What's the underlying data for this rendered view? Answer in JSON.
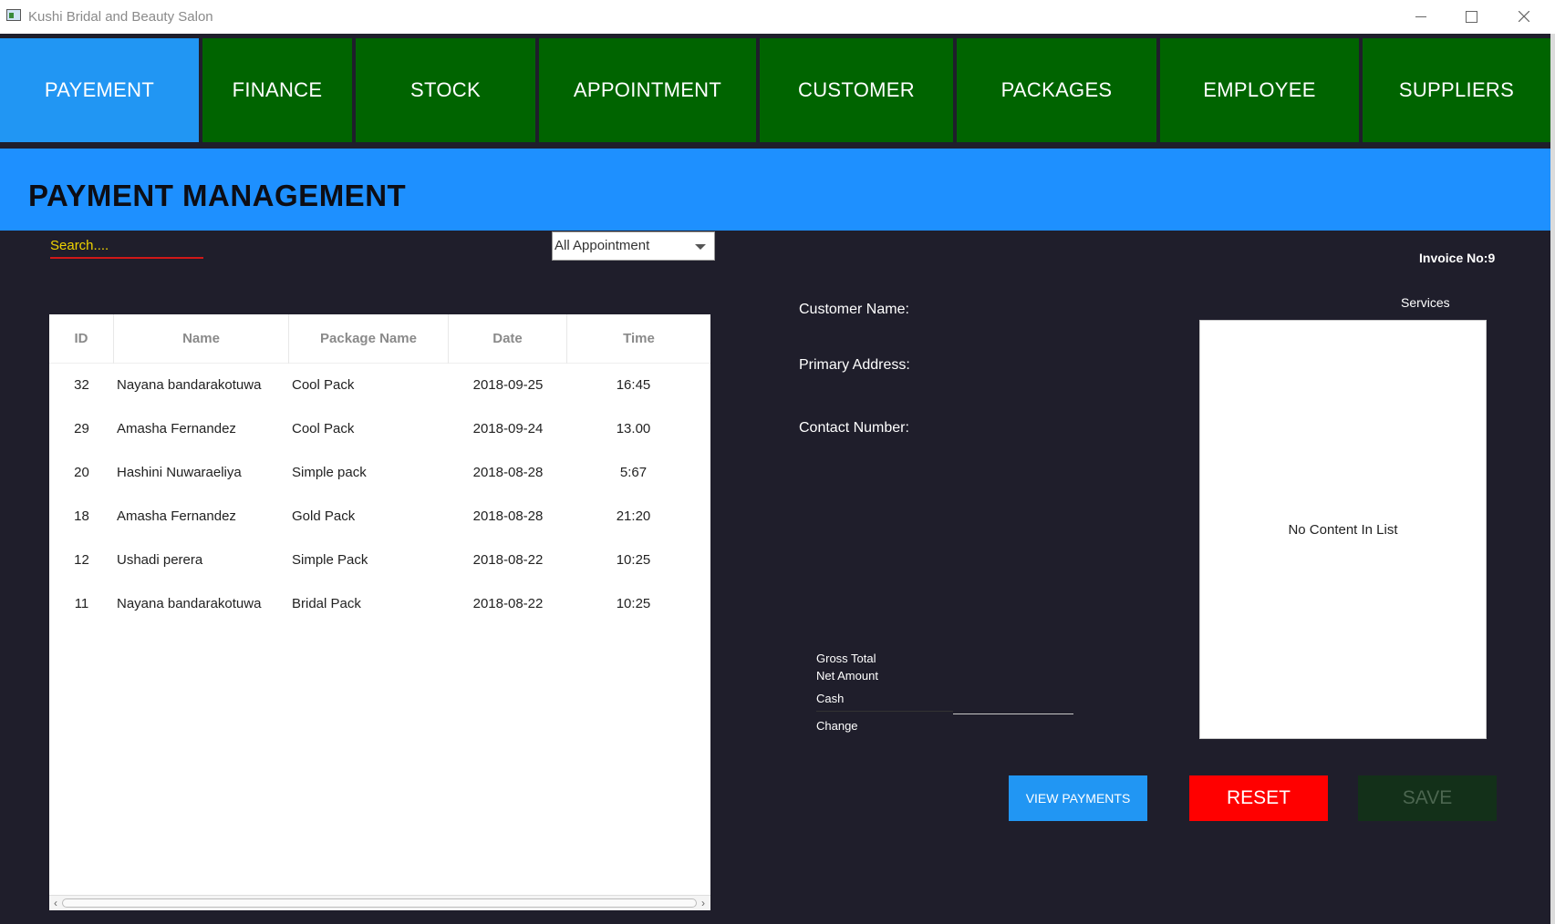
{
  "window": {
    "title": "Kushi Bridal and Beauty Salon",
    "minimize": "minimize-icon",
    "maximize": "maximize-icon",
    "close": "close-icon"
  },
  "nav": {
    "tabs": [
      {
        "label": "PAYEMENT",
        "active": true
      },
      {
        "label": "FINANCE"
      },
      {
        "label": "STOCK"
      },
      {
        "label": "APPOINTMENT"
      },
      {
        "label": "CUSTOMER"
      },
      {
        "label": "PACKAGES"
      },
      {
        "label": "EMPLOYEE"
      },
      {
        "label": "SUPPLIERS"
      }
    ]
  },
  "header": {
    "title": "PAYMENT MANAGEMENT"
  },
  "search": {
    "placeholder": "Search...."
  },
  "filter": {
    "selected": "All Appointment"
  },
  "table": {
    "columns": [
      "ID",
      "Name",
      "Package Name",
      "Date",
      "Time"
    ],
    "rows": [
      [
        "32",
        "Nayana bandarakotuwa",
        "Cool Pack",
        "2018-09-25",
        "16:45"
      ],
      [
        "29",
        "Amasha Fernandez",
        "Cool Pack",
        "2018-09-24",
        "13.00"
      ],
      [
        "20",
        "Hashini Nuwaraeliya",
        "Simple pack",
        "2018-08-28",
        "5:67"
      ],
      [
        "18",
        "Amasha Fernandez",
        "Gold Pack",
        "2018-08-28",
        "21:20"
      ],
      [
        "12",
        "Ushadi perera",
        "Simple Pack",
        "2018-08-22",
        "10:25"
      ],
      [
        "11",
        "Nayana bandarakotuwa",
        "Bridal Pack",
        "2018-08-22",
        "10:25"
      ]
    ]
  },
  "invoice": {
    "label": "Invoice No:9"
  },
  "customer": {
    "name_label": "Customer Name:",
    "address_label": "Primary Address:",
    "contact_label": "Contact Number:"
  },
  "services": {
    "title": "Services",
    "empty_text": "No Content In List"
  },
  "totals": {
    "gross_label": "Gross Total",
    "net_label": "Net Amount",
    "cash_label": "Cash",
    "change_label": "Change"
  },
  "buttons": {
    "view_payments": "VIEW PAYMENTS",
    "reset": "RESET",
    "save": "SAVE"
  },
  "colors": {
    "nav_active": "#2196f3",
    "nav_inactive": "#006400",
    "header": "#1e90ff",
    "background": "#1f1e2b",
    "reset": "#ff0000",
    "save": "#133019"
  }
}
